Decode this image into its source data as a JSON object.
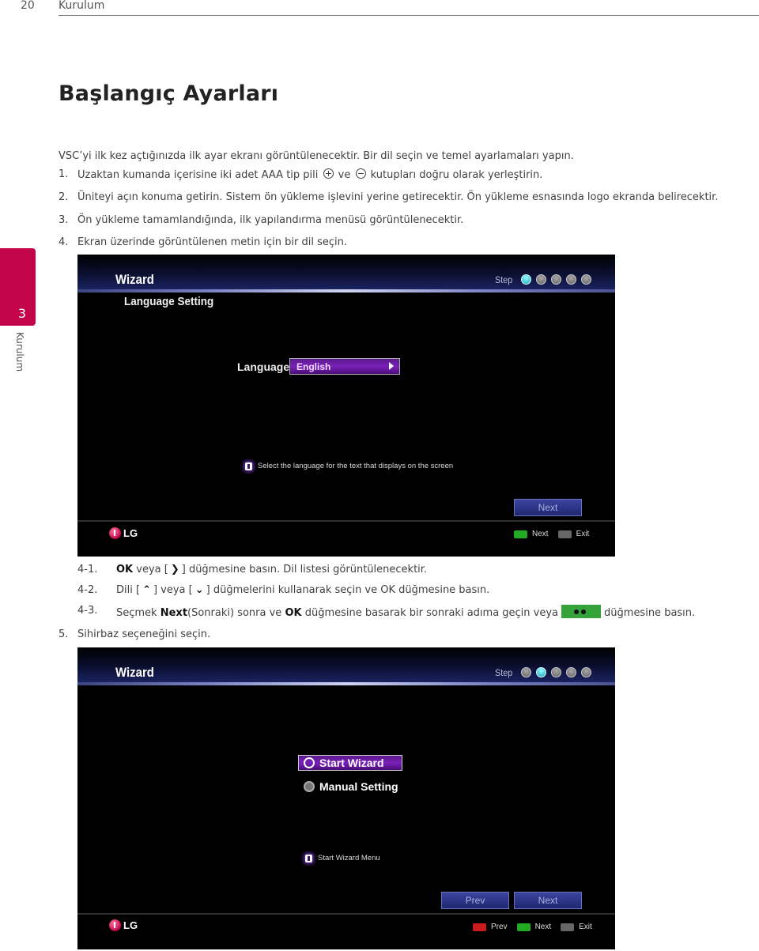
{
  "header": {
    "page_number": "20",
    "section": "Kurulum"
  },
  "side_tab": {
    "number": "3",
    "label": "Kurulum",
    "color": "#c4044a"
  },
  "title": "Başlangıç Ayarları",
  "intro": "VSC’yi ilk kez açtığınızda ilk ayar ekranı görüntülenecektir. Bir dil seçin ve temel ayarlamaları yapın.",
  "steps": [
    {
      "num": "1.",
      "pre": "Uzaktan kumanda içerisine iki adet AAA tip pili",
      "mid": "ve",
      "post": "kutupları doğru olarak yerleştirin."
    },
    {
      "num": "2.",
      "text": "Üniteyi açın konuma getirin. Sistem ön yükleme işlevini yerine getirecektir. Ön yükleme esnasında logo ekranda belirecektir."
    },
    {
      "num": "3.",
      "text": "Ön yükleme tamamlandığında, ilk yapılandırma menüsü görüntülenecektir."
    },
    {
      "num": "4.",
      "text": "Ekran üzerinde görüntülenen metin için bir dil seçin."
    }
  ],
  "screen1": {
    "title": "Wizard",
    "step_label": "Step",
    "step_total": 5,
    "step_current": 1,
    "subtitle": "Language Setting",
    "field_label": "Language",
    "field_value": "English",
    "info": "Select the language for the text that displays on the screen",
    "next_button": "Next",
    "logo": "LG",
    "legend": [
      {
        "key": "green",
        "label": "Next"
      },
      {
        "key": "back",
        "label": "Exit"
      }
    ]
  },
  "substeps": [
    {
      "num": "4-1.",
      "bold1": "OK",
      "t1": "veya [",
      "icon": "chevron-right",
      "t2": "] düğmesine basın. Dil listesi görüntülenecektir."
    },
    {
      "num": "4-2.",
      "t1": "Dili [",
      "icon1": "chevron-up",
      "t2": "] veya [",
      "icon2": "chevron-down",
      "t3": "] düğmelerini kullanarak seçin ve OK düğmesine basın."
    },
    {
      "num": "4-3.",
      "t1": "Seçmek",
      "bold1": "Next",
      "t2": "(Sonraki) sonra ve",
      "bold2": "OK",
      "t3": "düğmesine basarak bir sonraki adıma geçin veya",
      "t4": "düğmesine basın."
    }
  ],
  "step5": {
    "num": "5.",
    "text": "Sihirbaz seçeneğini seçin."
  },
  "screen2": {
    "title": "Wizard",
    "step_label": "Step",
    "step_total": 5,
    "step_current": 2,
    "options": [
      {
        "label": "Start Wizard",
        "selected": true
      },
      {
        "label": "Manual Setting",
        "selected": false
      }
    ],
    "info": "Start Wizard Menu",
    "prev_button": "Prev",
    "next_button": "Next",
    "logo": "LG",
    "legend": [
      {
        "key": "red",
        "label": "Prev"
      },
      {
        "key": "green",
        "label": "Next"
      },
      {
        "key": "back",
        "label": "Exit"
      }
    ]
  }
}
